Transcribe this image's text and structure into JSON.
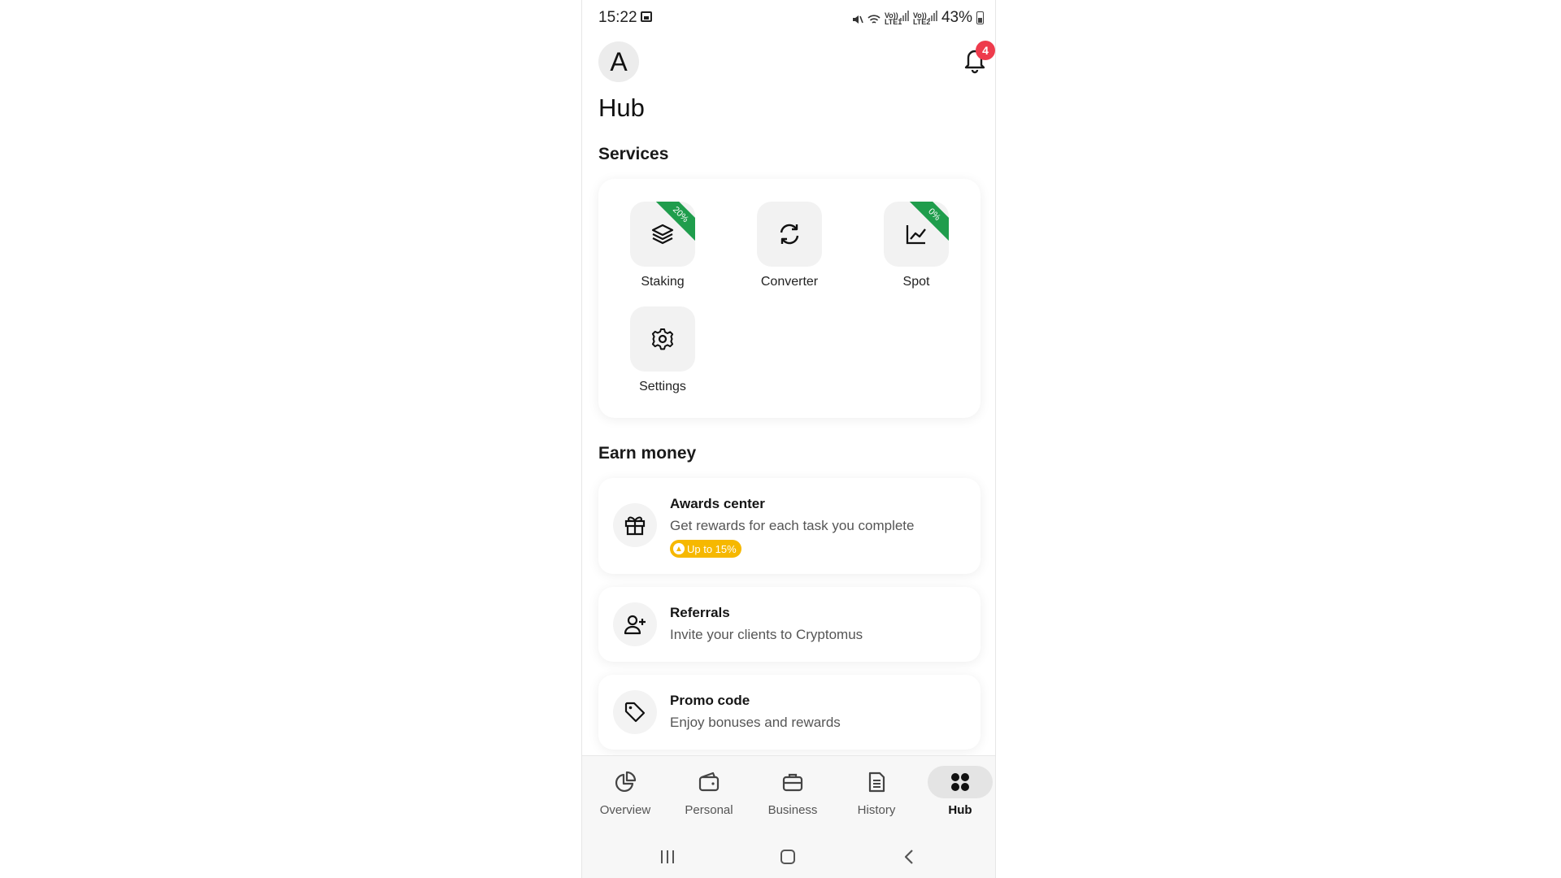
{
  "status_bar": {
    "time": "15:22",
    "sim1_label": "Vo)) LTE1",
    "sim2_label": "Vo)) LTE2",
    "battery": "43%"
  },
  "header": {
    "avatar_letter": "A",
    "notification_count": "4",
    "title": "Hub"
  },
  "services": {
    "section_title": "Services",
    "items": [
      {
        "label": "Staking",
        "icon": "layers-icon",
        "ribbon": "20%"
      },
      {
        "label": "Converter",
        "icon": "refresh-icon",
        "ribbon": ""
      },
      {
        "label": "Spot",
        "icon": "line-chart-icon",
        "ribbon": "0%"
      },
      {
        "label": "Settings",
        "icon": "gear-icon",
        "ribbon": ""
      }
    ]
  },
  "earn": {
    "section_title": "Earn money",
    "items": [
      {
        "title": "Awards center",
        "description": "Get rewards for each task you complete",
        "pill": "Up to 15%",
        "icon": "gift-icon"
      },
      {
        "title": "Referrals",
        "description": "Invite your clients to Cryptomus",
        "icon": "add-user-icon"
      },
      {
        "title": "Promo code",
        "description": "Enjoy bonuses and rewards",
        "icon": "tag-icon"
      }
    ]
  },
  "bottom_nav": {
    "items": [
      {
        "label": "Overview",
        "icon": "pie-chart-icon"
      },
      {
        "label": "Personal",
        "icon": "wallet-icon"
      },
      {
        "label": "Business",
        "icon": "briefcase-icon"
      },
      {
        "label": "History",
        "icon": "document-icon"
      },
      {
        "label": "Hub",
        "icon": "grid-icon"
      }
    ],
    "active": "Hub"
  },
  "colors": {
    "ribbon_green": "#1f9d4c",
    "badge_red": "#ee3b4c",
    "pill_yellow": "#f6b800"
  }
}
